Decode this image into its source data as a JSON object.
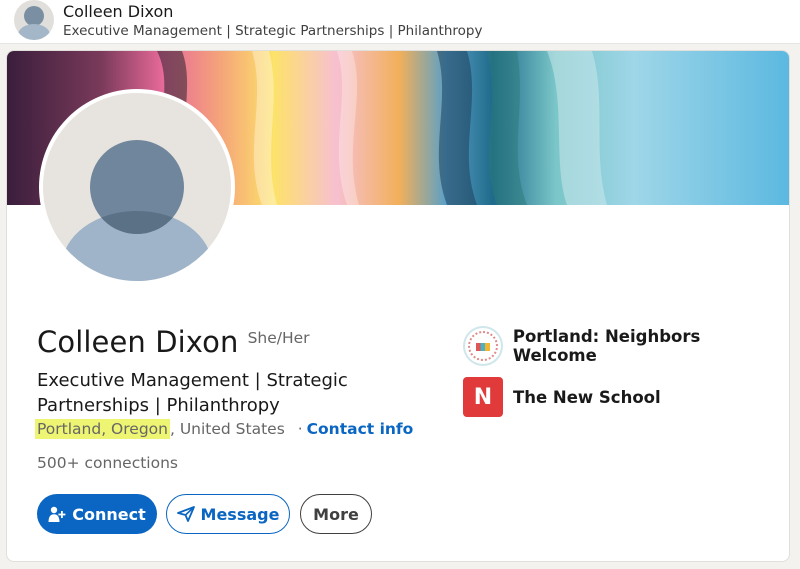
{
  "header": {
    "name": "Colleen Dixon",
    "headline": "Executive Management | Strategic Partnerships | Philanthropy"
  },
  "profile": {
    "name": "Colleen Dixon",
    "pronouns": "She/Her",
    "headline": "Executive Management | Strategic Partnerships | Philanthropy",
    "location_highlight": "Portland, Oregon",
    "location_rest": ", United States",
    "separator": "·",
    "contact_label": "Contact info",
    "connections": "500+ connections"
  },
  "actions": {
    "connect_label": "Connect",
    "message_label": "Message",
    "more_label": "More"
  },
  "organizations": [
    {
      "name": "Portland: Neighbors Welcome",
      "icon": "portland-neighbors-welcome-logo"
    },
    {
      "name": "The New School",
      "icon": "the-new-school-logo",
      "logo_letter": "N"
    }
  ],
  "colors": {
    "primary": "#0a66c2",
    "highlight": "#eef572",
    "new_school_red": "#e03a3a"
  }
}
